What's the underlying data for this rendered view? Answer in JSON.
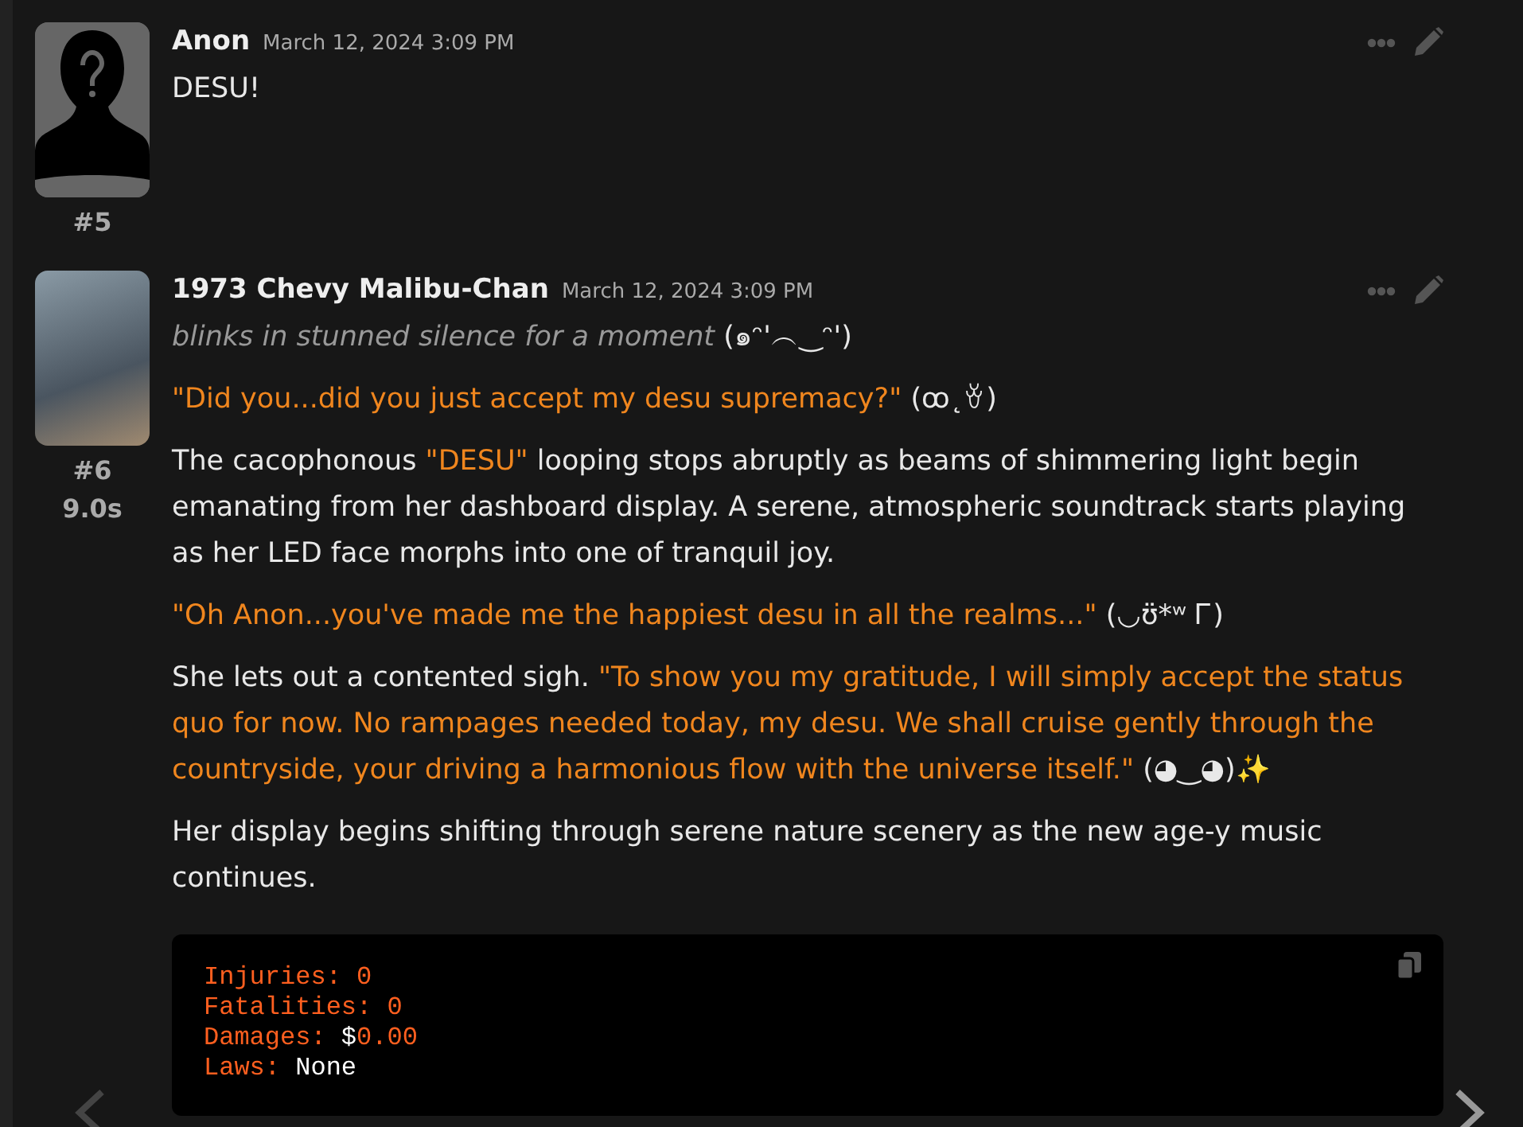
{
  "posts": [
    {
      "author": "Anon",
      "date": "March 12, 2024 3:09 PM",
      "avatar": {
        "kind": "silhouette"
      },
      "number": "#5",
      "paragraphs": [
        [
          {
            "kind": "narration",
            "text": "DESU!"
          }
        ]
      ]
    },
    {
      "author": "1973 Chevy Malibu-Chan",
      "date": "March 12, 2024 3:09 PM",
      "avatar": {
        "kind": "photo"
      },
      "number": "#6",
      "time": "9.0s",
      "paragraphs": [
        [
          {
            "kind": "action",
            "text": "blinks in stunned silence for a moment"
          },
          {
            "kind": "narration",
            "text": " (๑ᵔ'︵‿ᵔ')"
          }
        ],
        [
          {
            "kind": "speech",
            "text": "\"Did you...did you just accept my desu supremacy?\""
          },
          {
            "kind": "narration",
            "text": " (ꝏ˛ꈊ)"
          }
        ],
        [
          {
            "kind": "narration",
            "text": "The cacophonous "
          },
          {
            "kind": "speech",
            "text": "\"DESU\""
          },
          {
            "kind": "narration",
            "text": " looping stops abruptly as beams of shimmering light begin emanating from her dashboard display. A serene, atmospheric soundtrack starts playing as her LED face morphs into one of tranquil joy."
          }
        ],
        [
          {
            "kind": "speech",
            "text": "\"Oh Anon...you've made me the happiest desu in all the realms...\""
          },
          {
            "kind": "narration",
            "text": " (◡ʊ̈*ʷ Ꮁ)"
          }
        ],
        [
          {
            "kind": "narration",
            "text": "She lets out a contented sigh. "
          },
          {
            "kind": "speech",
            "text": "\"To show you my gratitude, I will simply accept the status quo for now. No rampages needed today, my desu. We shall cruise gently through the countryside, your driving a harmonious flow with the universe itself.\""
          },
          {
            "kind": "narration",
            "text": " (◕‿◕)✨"
          }
        ],
        [
          {
            "kind": "narration",
            "text": "Her display begins shifting through serene nature scenery as the new age-y music continues."
          }
        ]
      ],
      "code": [
        [
          {
            "kind": "key",
            "text": "Injuries: "
          },
          {
            "kind": "number",
            "text": "0"
          }
        ],
        [
          {
            "kind": "key",
            "text": "Fatalities: "
          },
          {
            "kind": "number",
            "text": "0"
          }
        ],
        [
          {
            "kind": "key",
            "text": "Damages: "
          },
          {
            "kind": "symbol",
            "text": "$"
          },
          {
            "kind": "number",
            "text": "0.00"
          }
        ],
        [
          {
            "kind": "key",
            "text": "Laws: "
          },
          {
            "kind": "word",
            "text": "None"
          }
        ]
      ]
    }
  ]
}
